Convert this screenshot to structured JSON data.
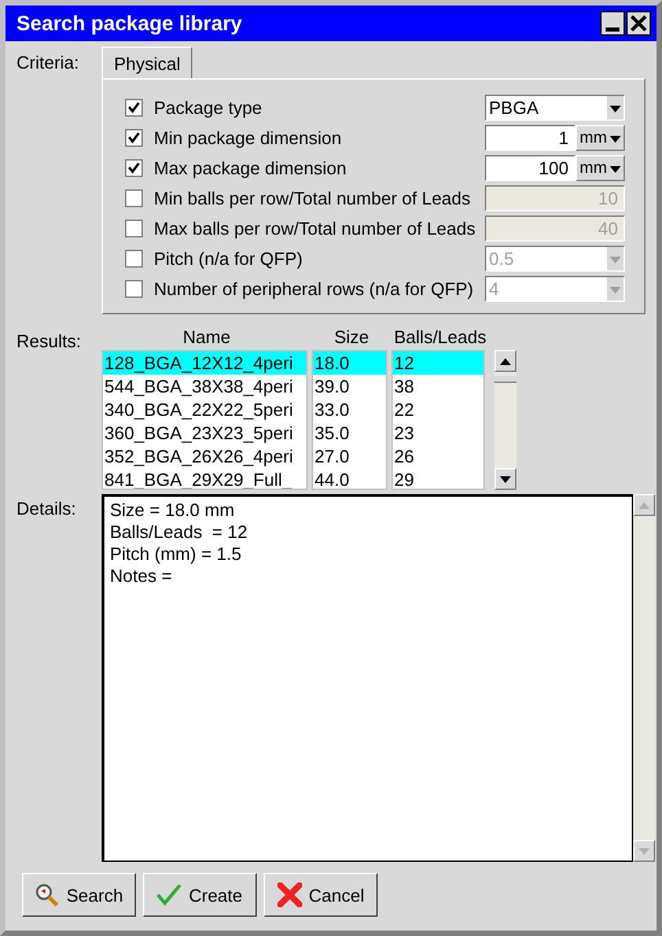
{
  "window": {
    "title": "Search package library"
  },
  "criteria": {
    "label": "Criteria:",
    "tabs": [
      {
        "label": "Physical",
        "selected": true
      }
    ],
    "rows": [
      {
        "label": "Package type",
        "checked": true,
        "kind": "combo",
        "value": "PBGA",
        "disabled": false
      },
      {
        "label": "Min package dimension",
        "checked": true,
        "kind": "unit",
        "value": "1",
        "unit": "mm",
        "disabled": false
      },
      {
        "label": "Max package dimension",
        "checked": true,
        "kind": "unit",
        "value": "100",
        "unit": "mm",
        "disabled": false
      },
      {
        "label": "Min balls per row/Total number of Leads",
        "checked": false,
        "kind": "field",
        "value": "10",
        "disabled": true
      },
      {
        "label": "Max balls per row/Total number of Leads",
        "checked": false,
        "kind": "field",
        "value": "40",
        "disabled": true
      },
      {
        "label": "Pitch (n/a for QFP)",
        "checked": false,
        "kind": "combo",
        "value": "0.5",
        "disabled": true
      },
      {
        "label": "Number of peripheral rows (n/a for QFP)",
        "checked": false,
        "kind": "combo",
        "value": "4",
        "disabled": true
      }
    ]
  },
  "results": {
    "label": "Results:",
    "columns": [
      "Name",
      "Size",
      "Balls/Leads"
    ],
    "rows": [
      {
        "cells": [
          "128_BGA_12X12_4peri",
          "18.0",
          "12"
        ],
        "selected": true
      },
      {
        "cells": [
          "544_BGA_38X38_4peri",
          "39.0",
          "38"
        ],
        "selected": false
      },
      {
        "cells": [
          "340_BGA_22X22_5peri",
          "33.0",
          "22"
        ],
        "selected": false
      },
      {
        "cells": [
          "360_BGA_23X23_5peri",
          "35.0",
          "23"
        ],
        "selected": false
      },
      {
        "cells": [
          "352_BGA_26X26_4peri",
          "27.0",
          "26"
        ],
        "selected": false
      },
      {
        "cells": [
          "841_BGA_29X29_Full_",
          "44.0",
          "29"
        ],
        "selected": false
      }
    ]
  },
  "details": {
    "label": "Details:",
    "lines": [
      "Size = 18.0 mm",
      "Balls/Leads  = 12",
      "Pitch (mm) = 1.5",
      "Notes ="
    ]
  },
  "buttons": [
    {
      "label": "Search",
      "kind": "search"
    },
    {
      "label": "Create",
      "kind": "create"
    },
    {
      "label": "Cancel",
      "kind": "cancel"
    }
  ]
}
